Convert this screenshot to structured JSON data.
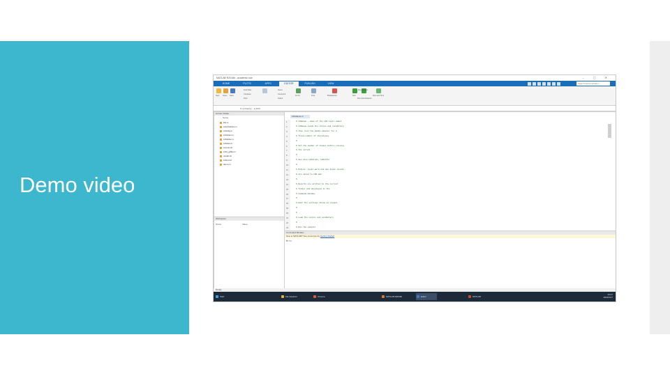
{
  "slide": {
    "title": "Demo video"
  },
  "screenshot": {
    "window_title": "MATLAB R2016b - academic use",
    "tabs": [
      "HOME",
      "PLOTS",
      "APPS",
      "EDITOR",
      "PUBLISH",
      "VIEW"
    ],
    "active_tab": "EDITOR",
    "search_placeholder": "Search Documentation",
    "ribbon": {
      "new_label": "New",
      "open_label": "Open",
      "save_label": "Save",
      "find_files_label": "Find Files",
      "compare_label": "Compare",
      "print_label": "Print",
      "insert_label": "Insert",
      "comment_label": "Comment",
      "indent_label": "Indent",
      "go_to_label": "Go To",
      "find_label": "Find",
      "breakpoints_label": "Breakpoints",
      "run_label": "Run",
      "run_advance_label": "Run and Advance",
      "run_section_label": "Run Section",
      "run_time_label": "Run and Time"
    },
    "address_path": "C: ▸ Users ▸ ... ▸ LDA",
    "current_folder_header": "Current Folder",
    "folder_column": "Name",
    "files": [
      "lda.m",
      "estLDAtrans.m",
      "LDAcfg.m",
      "LDAtrain.m",
      "LDAinfer.m",
      "LDAset.m",
      "corpus.txt",
      "LDA_gibbs.m",
      "vocab.txt",
      "LDA.mat",
      "demo.m"
    ],
    "workspace_header": "Workspace",
    "workspace_columns": [
      "Name",
      "Value"
    ],
    "editor_tab": "LDAdemo.m",
    "code_lines": [
      {
        "n": "1",
        "text": "% LDAdemo — demo of the LDA topic model"
      },
      {
        "n": "2",
        "text": "% LDAdemo loads the corpus and vocabulary"
      },
      {
        "n": "3",
        "text": "%   then runs the Gibbs sampler for a"
      },
      {
        "n": "4",
        "text": "%   fixed number of iterations."
      },
      {
        "n": "5",
        "text": "%"
      },
      {
        "n": "6",
        "text": "%   Set the number of topics before running"
      },
      {
        "n": "7",
        "text": "%   the script."
      },
      {
        "n": "8",
        "text": "%"
      },
      {
        "n": "9",
        "text": "%   See also LDAtrain, LDAinfer"
      },
      {
        "n": "10",
        "text": "%"
      },
      {
        "n": "11",
        "text": "%   Output: topic-word and doc-topic counts"
      },
      {
        "n": "12",
        "text": "%   are saved to LDA.mat."
      },
      {
        "n": "13",
        "text": "%"
      },
      {
        "n": "14",
        "text": "%   Results are written to the current"
      },
      {
        "n": "15",
        "text": "%   folder and displayed in the"
      },
      {
        "n": "16",
        "text": "%   Command Window."
      },
      {
        "n": "17",
        "text": "%"
      },
      {
        "n": "18",
        "text": "%   Edit the settings below as needed."
      },
      {
        "n": "19",
        "text": "%"
      },
      {
        "n": "20",
        "text": "%"
      },
      {
        "n": "21",
        "text": "% Load the corpus and vocabulary"
      },
      {
        "n": "22",
        "text": "%"
      },
      {
        "n": "23",
        "text": "% Run the sampler"
      }
    ],
    "command_window": {
      "header": "Command Window",
      "notice_text": "New to MATLAB? See resources for",
      "notice_link": "Getting Started",
      "prompt": "fx >>"
    },
    "status": "Ready",
    "taskbar": [
      {
        "label": "Start",
        "color": "#3aa0e8"
      },
      {
        "label": "File Explorer",
        "color": "#e6b23c"
      },
      {
        "label": "Chrome",
        "color": "#e0583a"
      },
      {
        "label": "MATLAB R2016b",
        "color": "#e07a2a"
      },
      {
        "label": "Editor",
        "color": "#3a78c8"
      },
      {
        "label": "MATLAB",
        "color": "#c84a2a"
      }
    ],
    "tray_time": "10:47",
    "tray_date": "2016/5/17"
  }
}
